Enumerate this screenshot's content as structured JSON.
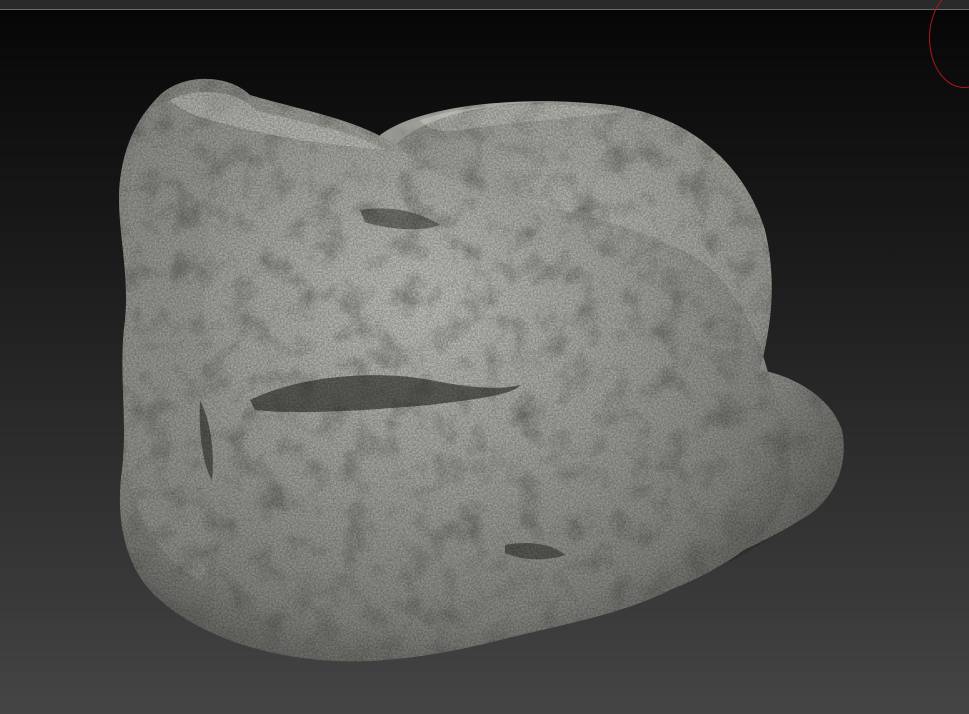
{
  "viewport": {
    "background_top": "#050505",
    "background_bottom": "#454545"
  },
  "model": {
    "icon": "sculpted-rock-mesh",
    "base_color": "#a9a9a4",
    "shadow_color": "#3a3a38",
    "highlight_color": "#d2d2cc"
  },
  "gizmo": {
    "icon": "rotation-gizmo-ring",
    "color": "#b01818"
  }
}
